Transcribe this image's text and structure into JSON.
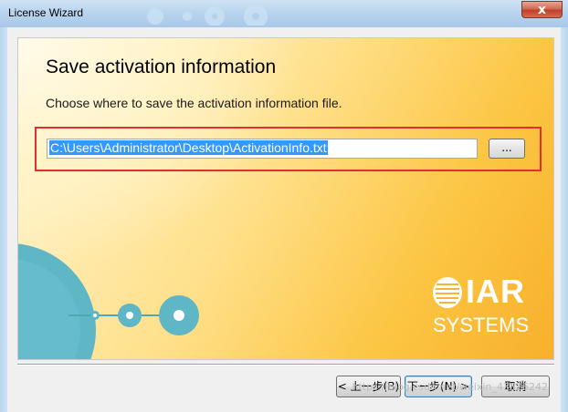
{
  "window": {
    "title": "License Wizard",
    "close_glyph": "x"
  },
  "page": {
    "heading": "Save activation information",
    "instruction": "Choose where to save the activation information file.",
    "file_path": "C:\\Users\\Administrator\\Desktop\\ActivationInfo.txt",
    "browse_label": "..."
  },
  "logo": {
    "brand": "IAR",
    "sub": "SYSTEMS"
  },
  "buttons": {
    "back": "< 上一步(B)",
    "next": "下一步(N) >",
    "cancel": "取消"
  },
  "watermark": "https://blog.csdn.net/weixin_43826242",
  "colors": {
    "accent_red": "#e03030",
    "selection_blue": "#3399ff",
    "banner_orange": "#f7b02c",
    "circle_teal": "#56b3c4"
  }
}
